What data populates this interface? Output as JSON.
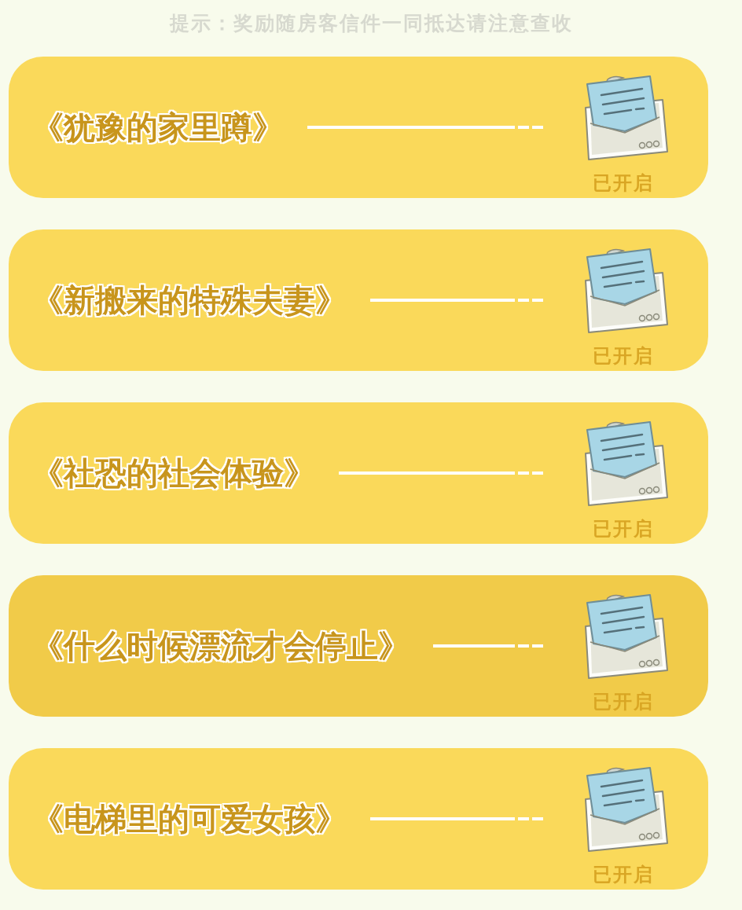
{
  "hint": "提示：奖励随房客信件一同抵达请注意查收",
  "letters": [
    {
      "title": "《犹豫的家里蹲》",
      "status": "已开启",
      "selected": false
    },
    {
      "title": "《新搬来的特殊夫妻》",
      "status": "已开启",
      "selected": false
    },
    {
      "title": "《社恐的社会体验》",
      "status": "已开启",
      "selected": false
    },
    {
      "title": "《什么时候漂流才会停止》",
      "status": "已开启",
      "selected": true
    },
    {
      "title": "《电梯里的可爱女孩》",
      "status": "已开启",
      "selected": false
    }
  ]
}
